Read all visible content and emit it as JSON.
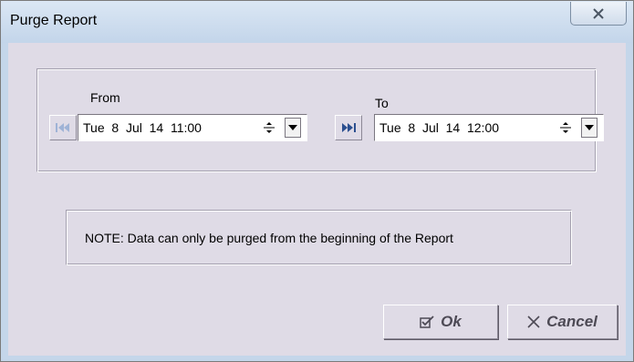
{
  "window": {
    "title": "Purge Report",
    "close_icon": "close-icon"
  },
  "range": {
    "from_label": "From",
    "to_label": "To",
    "from_value": "Tue  8  Jul  14  11:00",
    "to_value": "Tue  8  Jul  14  12:00",
    "from_nav_icon": "skip-to-start-icon",
    "to_nav_icon": "skip-to-end-icon"
  },
  "note": {
    "text": "NOTE: Data can only be purged from the beginning of the Report"
  },
  "buttons": {
    "ok_label": "Ok",
    "cancel_label": "Cancel",
    "ok_icon": "checkbox-check-icon",
    "cancel_icon": "x-icon"
  },
  "colors": {
    "dialog_bg": "#dfdbe6",
    "title_bg": "#c4d6ea",
    "nav_disabled": "#9fb3d6",
    "nav_active": "#2b4f8f"
  }
}
